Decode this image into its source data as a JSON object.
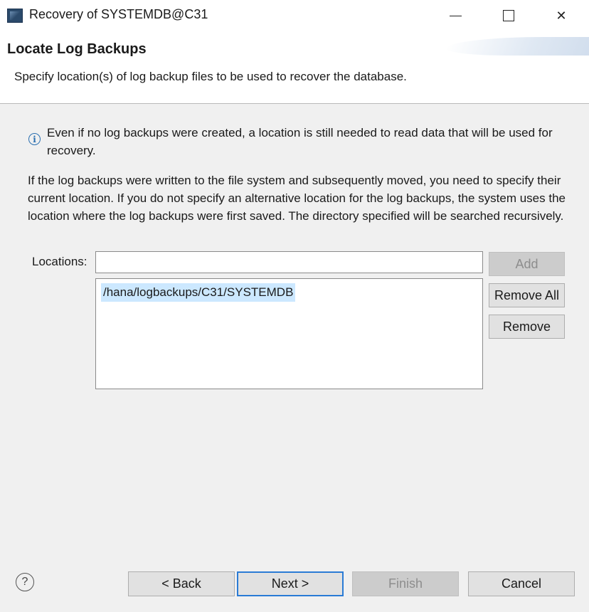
{
  "window": {
    "title": "Recovery of SYSTEMDB@C31",
    "icon": "app-icon",
    "controls": {
      "minimize": "minimize-icon",
      "maximize": "maximize-icon",
      "close_glyph": "✕"
    }
  },
  "header": {
    "title": "Locate Log Backups",
    "description": "Specify location(s) of log backup files to be used to recover the database."
  },
  "info": {
    "icon": "info-icon",
    "icon_glyph": "i",
    "text": "Even if no log backups were created, a location is still needed to read data that will be used for recovery."
  },
  "paragraph": "If the log backups were written to the file system and subsequently moved, you need to specify their current location. If you do not specify an alternative location for the log backups, the system uses the location where the log backups were first saved. The directory specified will be searched recursively.",
  "locations": {
    "label": "Locations:",
    "input_value": "",
    "items": [
      "/hana/logbackups/C31/SYSTEMDB"
    ],
    "selected_index": 0
  },
  "side_buttons": {
    "add": "Add",
    "remove_all": "Remove All",
    "remove": "Remove"
  },
  "footer": {
    "help_glyph": "?",
    "back": "< Back",
    "next": "Next >",
    "finish": "Finish",
    "cancel": "Cancel"
  },
  "colors": {
    "accent": "#2a7bd5",
    "selection": "#cce8ff",
    "info": "#2a6fb0"
  }
}
